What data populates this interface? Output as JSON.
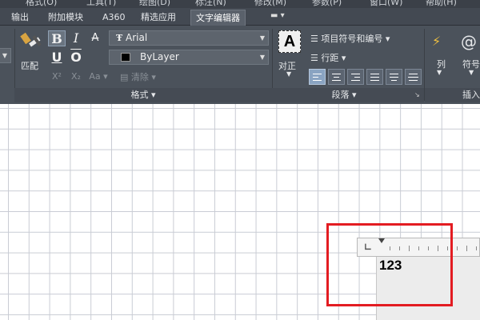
{
  "menubar": {
    "items": [
      "格式(O)",
      "工具(T)",
      "绘图(D)",
      "标注(N)",
      "修改(M)",
      "参数(P)",
      "窗口(W)",
      "帮助(H)"
    ]
  },
  "tabs": [
    {
      "label": "输出",
      "active": false
    },
    {
      "label": "附加模块",
      "active": false
    },
    {
      "label": "A360",
      "active": false
    },
    {
      "label": "精选应用",
      "active": false
    },
    {
      "label": "文字编辑器",
      "active": true
    }
  ],
  "ribbon": {
    "match_label": "匹配",
    "format": {
      "bold": "B",
      "italic": "I",
      "strike": "A",
      "underline": "U",
      "overline": "O",
      "superscript": "X²",
      "subscript": "X₂",
      "case": "Aa",
      "clear": "清除",
      "font_value": "Arial",
      "color_value": "ByLayer",
      "panel_title": "格式"
    },
    "paragraph": {
      "justify_label": "对正",
      "bullets_label": "项目符号和编号",
      "line_spacing_label": "行距",
      "panel_title": "段落"
    },
    "insert": {
      "columns_label": "列",
      "symbol_label": "符号",
      "panel_title": "插入"
    }
  },
  "canvas": {
    "mtext_value": "123"
  },
  "colors": {
    "ribbon_bg": "#4b525b",
    "highlight": "#e31c22",
    "active_align": "#8aa4c2"
  }
}
